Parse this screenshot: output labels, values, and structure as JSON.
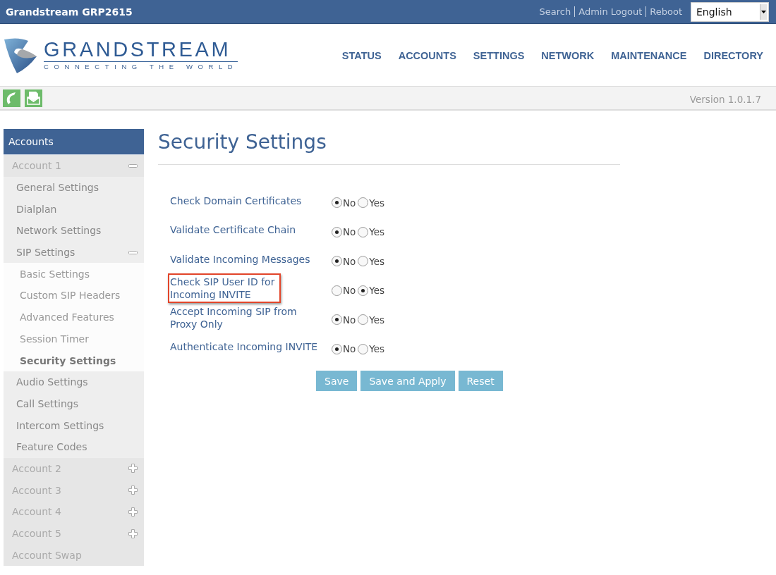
{
  "window": {
    "title": "Grandstream GRP2615"
  },
  "top_links": [
    {
      "label": "Search"
    },
    {
      "label": "Admin Logout"
    },
    {
      "label": "Reboot"
    }
  ],
  "language_select": {
    "value": "English"
  },
  "logo": {
    "name": "GRANDSTREAM",
    "tagline": "CONNECTING THE WORLD"
  },
  "nav": [
    {
      "label": "STATUS"
    },
    {
      "label": "ACCOUNTS"
    },
    {
      "label": "SETTINGS"
    },
    {
      "label": "NETWORK"
    },
    {
      "label": "MAINTENANCE"
    },
    {
      "label": "DIRECTORY"
    }
  ],
  "version": "Version 1.0.1.7",
  "sidebar": {
    "title": "Accounts",
    "items": [
      {
        "label": "Account 1",
        "expanded": true,
        "selected": false,
        "children": [
          {
            "label": "General Settings",
            "selected": false
          },
          {
            "label": "Dialplan",
            "selected": false
          },
          {
            "label": "Network Settings",
            "selected": false
          },
          {
            "label": "SIP Settings",
            "expanded": true,
            "selected": false,
            "children": [
              {
                "label": "Basic Settings",
                "selected": false
              },
              {
                "label": "Custom SIP Headers",
                "selected": false
              },
              {
                "label": "Advanced Features",
                "selected": false
              },
              {
                "label": "Session Timer",
                "selected": false
              },
              {
                "label": "Security Settings",
                "selected": true
              }
            ]
          },
          {
            "label": "Audio Settings",
            "selected": false
          },
          {
            "label": "Call Settings",
            "selected": false
          },
          {
            "label": "Intercom Settings",
            "selected": false
          },
          {
            "label": "Feature Codes",
            "selected": false
          }
        ]
      },
      {
        "label": "Account 2",
        "expanded": false,
        "selected": false
      },
      {
        "label": "Account 3",
        "expanded": false,
        "selected": false
      },
      {
        "label": "Account 4",
        "expanded": false,
        "selected": false
      },
      {
        "label": "Account 5",
        "expanded": false,
        "selected": false
      },
      {
        "label": "Account Swap",
        "selected": false
      }
    ]
  },
  "page_title": "Security Settings",
  "settings": [
    {
      "label": "Check Domain Certificates",
      "highlighted": false,
      "options": [
        {
          "label": "No",
          "selected": true
        },
        {
          "label": "Yes",
          "selected": false
        }
      ]
    },
    {
      "label": "Validate Certificate Chain",
      "highlighted": false,
      "options": [
        {
          "label": "No",
          "selected": true
        },
        {
          "label": "Yes",
          "selected": false
        }
      ]
    },
    {
      "label": "Validate Incoming Messages",
      "highlighted": false,
      "options": [
        {
          "label": "No",
          "selected": true
        },
        {
          "label": "Yes",
          "selected": false
        }
      ]
    },
    {
      "label": "Check SIP User ID for Incoming INVITE",
      "highlighted": true,
      "options": [
        {
          "label": "No",
          "selected": false
        },
        {
          "label": "Yes",
          "selected": true
        }
      ]
    },
    {
      "label": "Accept Incoming SIP from Proxy Only",
      "highlighted": false,
      "options": [
        {
          "label": "No",
          "selected": true
        },
        {
          "label": "Yes",
          "selected": false
        }
      ]
    },
    {
      "label": "Authenticate Incoming INVITE",
      "highlighted": false,
      "options": [
        {
          "label": "No",
          "selected": true
        },
        {
          "label": "Yes",
          "selected": false
        }
      ]
    }
  ],
  "buttons": [
    {
      "label": "Save"
    },
    {
      "label": "Save and Apply"
    },
    {
      "label": "Reset"
    }
  ]
}
